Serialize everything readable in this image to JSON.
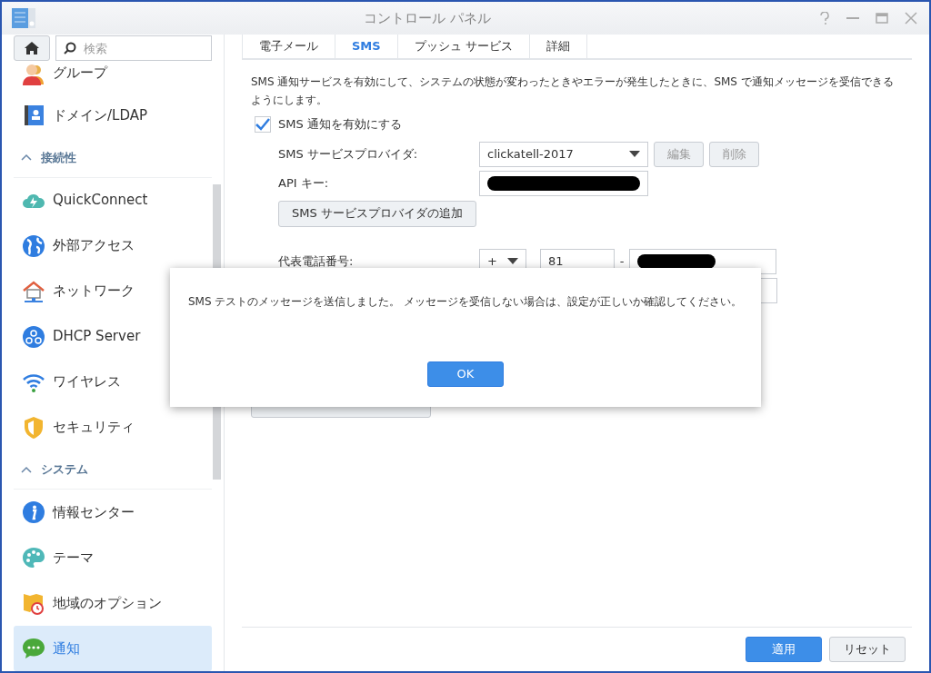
{
  "window": {
    "title": "コントロール パネル"
  },
  "search": {
    "placeholder": "検索"
  },
  "sidebar": [
    {
      "kind": "item",
      "label": "グループ",
      "selected": false
    },
    {
      "kind": "item",
      "label": "ドメイン/LDAP",
      "selected": false
    },
    {
      "kind": "header",
      "label": "接続性",
      "expanded": true
    },
    {
      "kind": "item",
      "label": "QuickConnect",
      "selected": false
    },
    {
      "kind": "item",
      "label": "外部アクセス",
      "selected": false
    },
    {
      "kind": "item",
      "label": "ネットワーク",
      "selected": false
    },
    {
      "kind": "item",
      "label": "DHCP Server",
      "selected": false
    },
    {
      "kind": "item",
      "label": "ワイヤレス",
      "selected": false
    },
    {
      "kind": "item",
      "label": "セキュリティ",
      "selected": false
    },
    {
      "kind": "header",
      "label": "システム",
      "expanded": true
    },
    {
      "kind": "item",
      "label": "情報センター",
      "selected": false
    },
    {
      "kind": "item",
      "label": "テーマ",
      "selected": false
    },
    {
      "kind": "item",
      "label": "地域のオプション",
      "selected": false
    },
    {
      "kind": "item",
      "label": "通知",
      "selected": true
    }
  ],
  "tabs": [
    {
      "label": "電子メール",
      "selected": false
    },
    {
      "label": "SMS",
      "selected": true
    },
    {
      "label": "プッシュ サービス",
      "selected": false
    },
    {
      "label": "詳細",
      "selected": false
    }
  ],
  "description": "SMS 通知サービスを有効にして、システムの状態が変わったときやエラーが発生したときに、SMS で通知メッセージを受信できるようにします。",
  "enable": {
    "label": "SMS 通知を有効にする",
    "checked": true
  },
  "provider": {
    "label": "SMS サービスプロバイダ:",
    "value": "clickatell-2017",
    "buttons": [
      {
        "label": "編集",
        "disabled": true
      },
      {
        "label": "削除",
        "disabled": true
      }
    ]
  },
  "api_key": {
    "label": "API キー:"
  },
  "add_provider": "SMS サービスプロバイダの追加",
  "phone": {
    "label": "代表電話番号:",
    "prefix": "+",
    "country_code": "81",
    "separator": "-"
  },
  "dialog": {
    "message": "SMS テストのメッセージを送信しました。 メッセージを受信しない場合は、設定が正しいか確認してください。",
    "button": "OK"
  },
  "footer": [
    {
      "label": "適用",
      "kind": "primary"
    },
    {
      "label": "リセット",
      "kind": "secondary"
    }
  ]
}
